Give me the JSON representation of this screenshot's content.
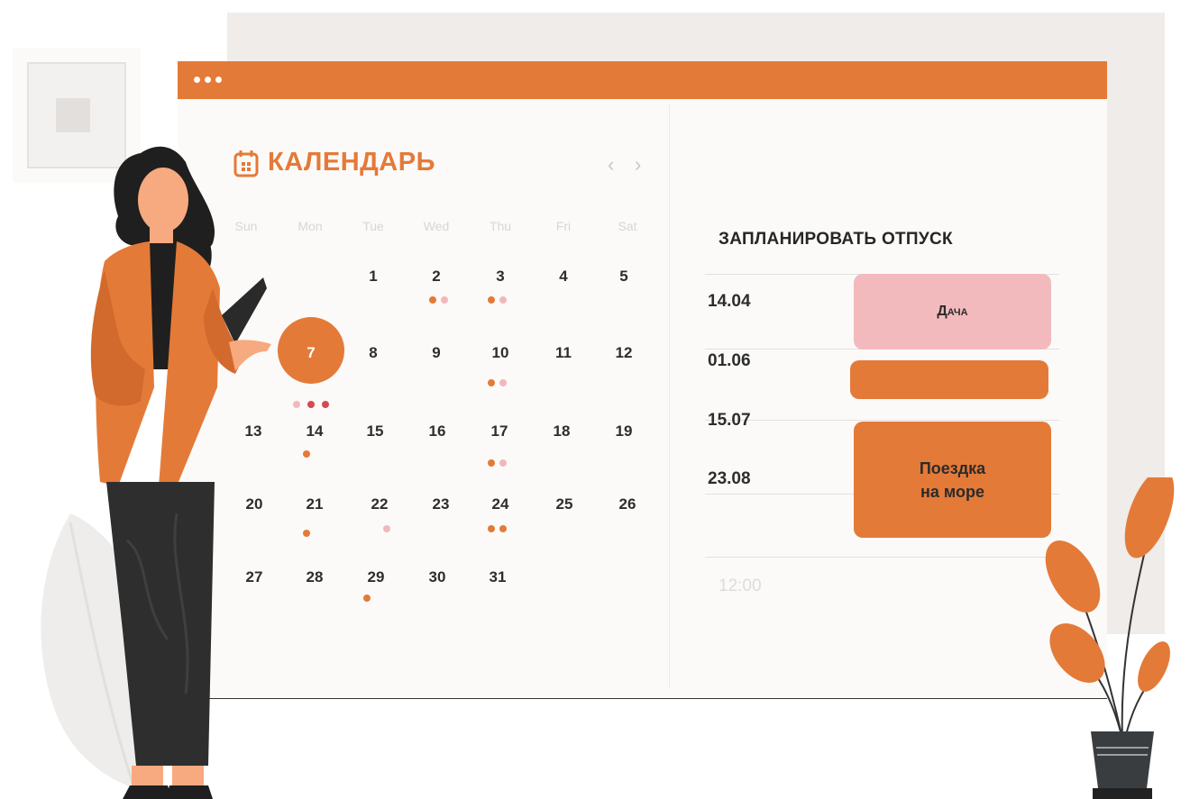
{
  "window": {
    "title_dots": [
      "dot",
      "dot",
      "dot"
    ]
  },
  "calendar": {
    "title": "КАЛЕНДАРЬ",
    "icon": "calendar-icon",
    "prev_label": "‹",
    "next_label": "›",
    "weekdays": [
      "Sun",
      "Mon",
      "Tue",
      "Wed",
      "Thu",
      "Fri",
      "Sat"
    ],
    "selected_day": "7",
    "weeks": [
      [
        "",
        "",
        "1",
        "2",
        "3",
        "4",
        "5"
      ],
      [
        "",
        "7",
        "8",
        "9",
        "10",
        "11",
        "12"
      ],
      [
        "13",
        "14",
        "15",
        "16",
        "17",
        "18",
        "19"
      ],
      [
        "20",
        "21",
        "22",
        "23",
        "24",
        "25",
        "26"
      ],
      [
        "27",
        "28",
        "29",
        "30",
        "31",
        "",
        ""
      ]
    ]
  },
  "schedule": {
    "title": "ЗАПЛАНИРОВАТЬ ОТПУСК",
    "dates": [
      "14.04",
      "01.06",
      "15.07",
      "23.08"
    ],
    "time": "12:00",
    "events": [
      {
        "label": "Дача",
        "color": "#f3babd"
      },
      {
        "label": "",
        "color": "#e47a38"
      },
      {
        "label": "Поездка\nна море",
        "color": "#e47a38"
      }
    ]
  },
  "colors": {
    "accent": "#e47a38",
    "pink": "#f3babd",
    "red": "#d8484f",
    "panel": "#efece9"
  }
}
